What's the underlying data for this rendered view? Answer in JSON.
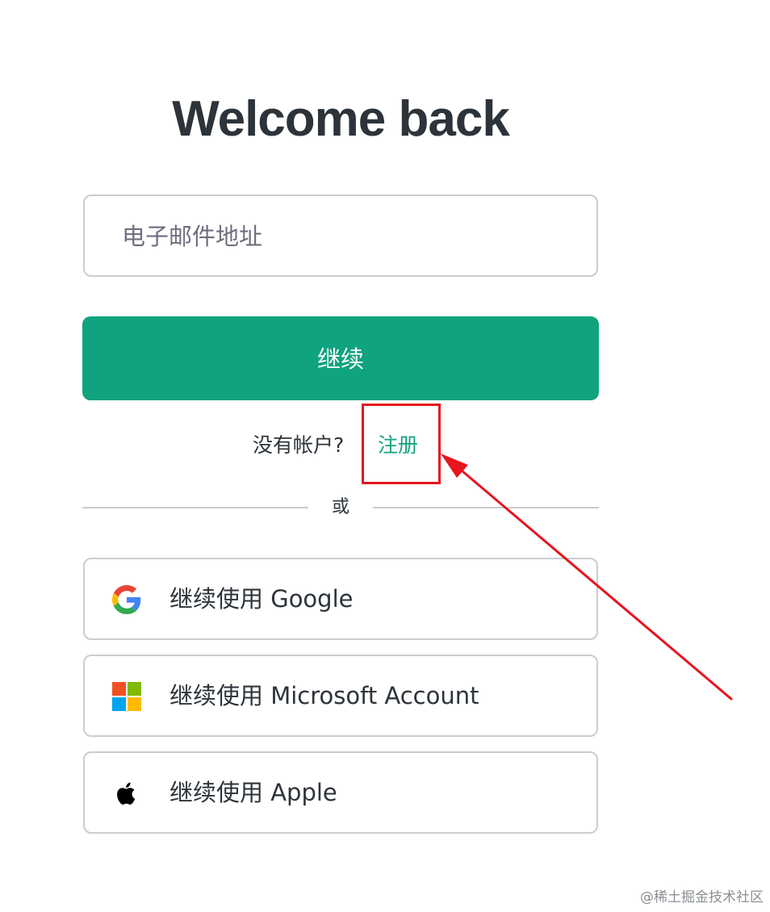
{
  "page": {
    "title": "Welcome back"
  },
  "form": {
    "email_placeholder": "电子邮件地址",
    "email_value": "",
    "continue_label": "继续"
  },
  "signup": {
    "prompt": "没有帐户?",
    "link_label": "注册"
  },
  "divider": {
    "label": "或"
  },
  "social": [
    {
      "label": "继续使用 Google",
      "icon": "google-icon"
    },
    {
      "label": "继续使用 Microsoft Account",
      "icon": "microsoft-icon"
    },
    {
      "label": "继续使用 Apple",
      "icon": "apple-icon"
    }
  ],
  "annotation": {
    "highlight_color": "#e8141d"
  },
  "watermark": {
    "text": "@稀土掘金技术社区"
  },
  "colors": {
    "accent": "#10a37f",
    "text": "#2d333a",
    "border": "#c9cdd2"
  }
}
